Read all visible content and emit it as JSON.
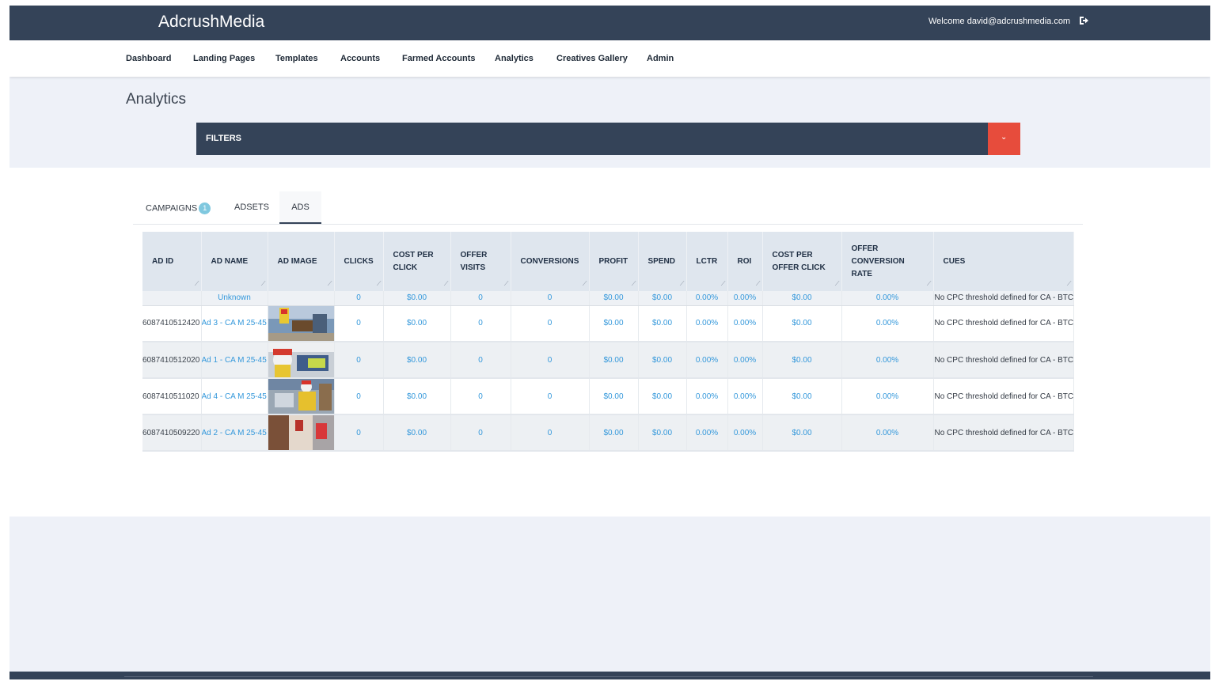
{
  "header": {
    "brand": "AdcrushMedia",
    "welcome": "Welcome david@adcrushmedia.com",
    "logout_icon": "logout-icon"
  },
  "nav": {
    "items": [
      "Dashboard",
      "Landing Pages",
      "Templates",
      "Accounts",
      "Farmed Accounts",
      "Analytics",
      "Creatives Gallery",
      "Admin"
    ]
  },
  "page": {
    "title": "Analytics"
  },
  "filters": {
    "label": "FILTERS",
    "toggle_icon": "chevron-down-icon",
    "toggle_glyph": "⌄"
  },
  "tabs": {
    "campaigns": "CAMPAIGNS",
    "campaigns_count": "1",
    "adsets": "ADSETS",
    "ads": "ADS",
    "active": "ADS"
  },
  "table": {
    "headers": [
      "AD ID",
      "AD NAME",
      "AD IMAGE",
      "CLICKS",
      "COST PER CLICK",
      "OFFER VISITS",
      "CONVERSIONS",
      "PROFIT",
      "SPEND",
      "LCTR",
      "ROI",
      "COST PER OFFER CLICK",
      "OFFER CONVERSION RATE",
      "CUES"
    ],
    "unknown_row": {
      "ad_id": "",
      "ad_name": "Unknown",
      "clicks": "0",
      "cpc": "$0.00",
      "offer_visits": "0",
      "conversions": "0",
      "profit": "$0.00",
      "spend": "$0.00",
      "lctr": "0.00%",
      "roi": "0.00%",
      "cpoc": "$0.00",
      "ocr": "0.00%",
      "cues": "No CPC threshold defined for CA - BTC"
    },
    "rows": [
      {
        "ad_id": "6087410512420",
        "ad_name": "Ad 3 - CA M 25-45",
        "clicks": "0",
        "cpc": "$0.00",
        "offer_visits": "0",
        "conversions": "0",
        "profit": "$0.00",
        "spend": "$0.00",
        "lctr": "0.00%",
        "roi": "0.00%",
        "cpoc": "$0.00",
        "ocr": "0.00%",
        "cues": "No CPC threshold defined for CA - BTC"
      },
      {
        "ad_id": "6087410512020",
        "ad_name": "Ad 1 - CA M 25-45",
        "clicks": "0",
        "cpc": "$0.00",
        "offer_visits": "0",
        "conversions": "0",
        "profit": "$0.00",
        "spend": "$0.00",
        "lctr": "0.00%",
        "roi": "0.00%",
        "cpoc": "$0.00",
        "ocr": "0.00%",
        "cues": "No CPC threshold defined for CA - BTC"
      },
      {
        "ad_id": "6087410511020",
        "ad_name": "Ad 4 - CA M 25-45",
        "clicks": "0",
        "cpc": "$0.00",
        "offer_visits": "0",
        "conversions": "0",
        "profit": "$0.00",
        "spend": "$0.00",
        "lctr": "0.00%",
        "roi": "0.00%",
        "cpoc": "$0.00",
        "ocr": "0.00%",
        "cues": "No CPC threshold defined for CA - BTC"
      },
      {
        "ad_id": "6087410509220",
        "ad_name": "Ad 2 - CA M 25-45",
        "clicks": "0",
        "cpc": "$0.00",
        "offer_visits": "0",
        "conversions": "0",
        "profit": "$0.00",
        "spend": "$0.00",
        "lctr": "0.00%",
        "roi": "0.00%",
        "cpoc": "$0.00",
        "ocr": "0.00%",
        "cues": "No CPC threshold defined for CA - BTC"
      }
    ]
  },
  "colors": {
    "header_bg": "#344358",
    "accent_red": "#e74c3c",
    "link_blue": "#3498db",
    "badge": "#7fc8df"
  }
}
